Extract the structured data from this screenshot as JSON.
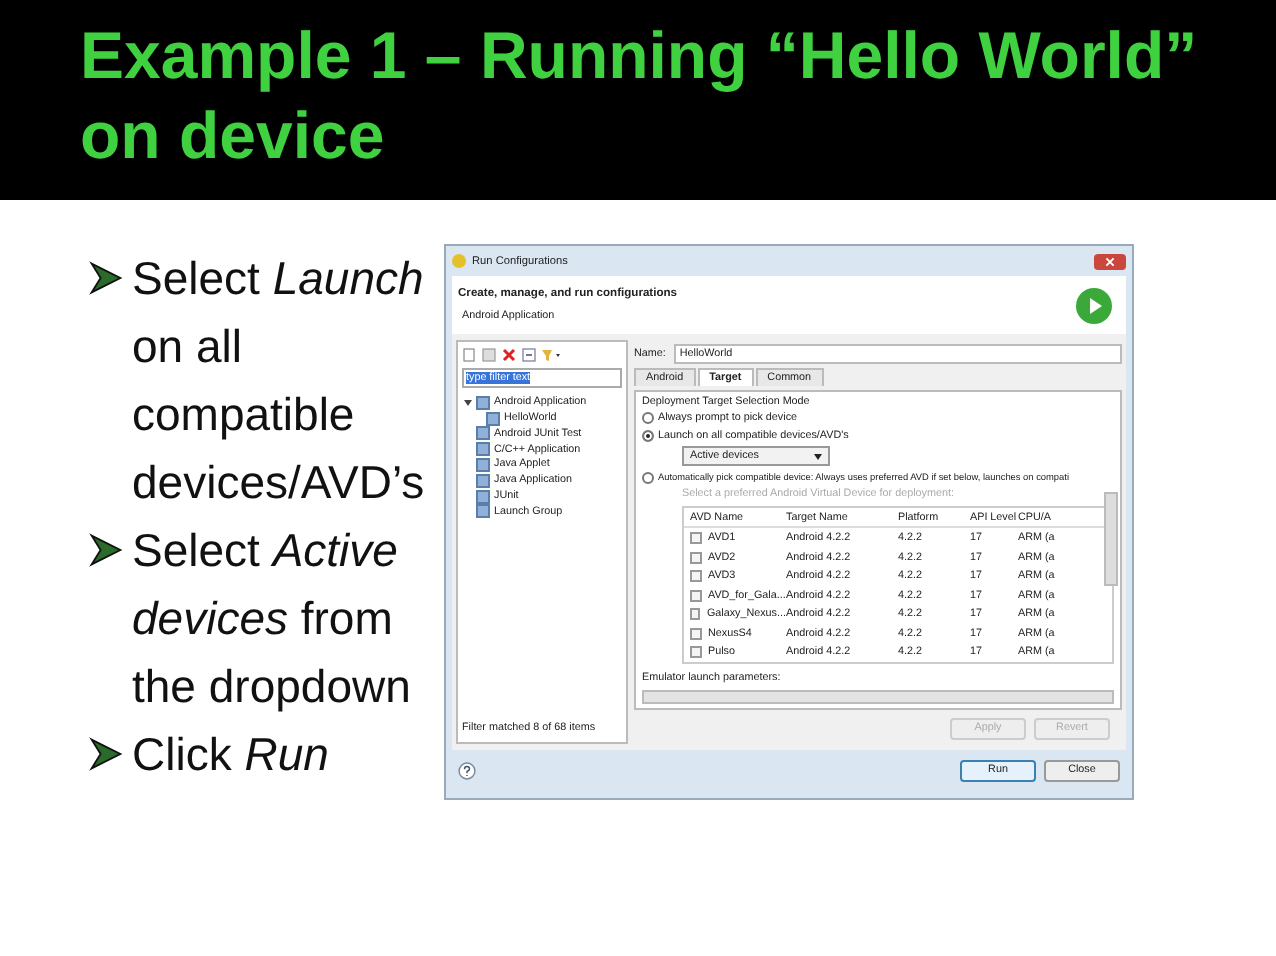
{
  "slide_title": "Example 1 – Running “Hello World” on device",
  "bullets": [
    {
      "text": "Select *Launch* on all compatible devices/AVD’s"
    },
    {
      "text": "Select *Active devices* from the dropdown"
    },
    {
      "text": "Click *Run*"
    }
  ],
  "dialog": {
    "title": "Run Configurations",
    "header_title": "Create, manage, and run configurations",
    "header_subtitle": "Android Application",
    "filter": {
      "value": "type filter text"
    },
    "tree": [
      {
        "label": "Android Application",
        "expanded": true,
        "children": [
          {
            "label": "HelloWorld"
          }
        ]
      },
      {
        "label": "Android JUnit Test"
      },
      {
        "label": "C/C++ Application"
      },
      {
        "label": "Java Applet"
      },
      {
        "label": "Java Application"
      },
      {
        "label": "JUnit"
      },
      {
        "label": "Launch Group"
      }
    ],
    "filter_status": "Filter matched 8 of 68 items",
    "name_label": "Name:",
    "name_value": "HelloWorld",
    "tabs": [
      {
        "label": "Android",
        "selected": false
      },
      {
        "label": "Target",
        "selected": true
      },
      {
        "label": "Common",
        "selected": false
      }
    ],
    "mode_heading": "Deployment Target Selection Mode",
    "modes": [
      {
        "label": "Always prompt to pick device",
        "selected": false
      },
      {
        "label": "Launch on all compatible devices/AVD's",
        "selected": true
      },
      {
        "label": "Automatically pick compatible device: Always uses preferred AVD if set below, launches on compati",
        "selected": false
      }
    ],
    "device_dropdown": "Active devices",
    "avd_hint": "Select a preferred Android Virtual Device for deployment:",
    "columns": [
      "AVD Name",
      "Target Name",
      "Platform",
      "API Level",
      "CPU/A"
    ],
    "rows": [
      {
        "cells": [
          "AVD1",
          "Android 4.2.2",
          "4.2.2",
          "17",
          "ARM (a"
        ],
        "checked": false
      },
      {
        "cells": [
          "AVD2",
          "Android 4.2.2",
          "4.2.2",
          "17",
          "ARM (a"
        ],
        "checked": false
      },
      {
        "cells": [
          "AVD3",
          "Android 4.2.2",
          "4.2.2",
          "17",
          "ARM (a"
        ],
        "checked": false
      },
      {
        "cells": [
          "AVD_for_Gala...",
          "Android 4.2.2",
          "4.2.2",
          "17",
          "ARM (a"
        ],
        "checked": false
      },
      {
        "cells": [
          "Galaxy_Nexus...",
          "Android 4.2.2",
          "4.2.2",
          "17",
          "ARM (a"
        ],
        "checked": false
      },
      {
        "cells": [
          "NexusS4",
          "Android 4.2.2",
          "4.2.2",
          "17",
          "ARM (a"
        ],
        "checked": false
      },
      {
        "cells": [
          "Pulso",
          "Android 4.2.2",
          "4.2.2",
          "17",
          "ARM (a"
        ],
        "checked": false
      }
    ],
    "emulator_label": "Emulator launch parameters:",
    "apply": {
      "label": "Apply",
      "disabled": true
    },
    "revert": {
      "label": "Revert",
      "disabled": true
    },
    "run": "Run",
    "close": "Close"
  }
}
